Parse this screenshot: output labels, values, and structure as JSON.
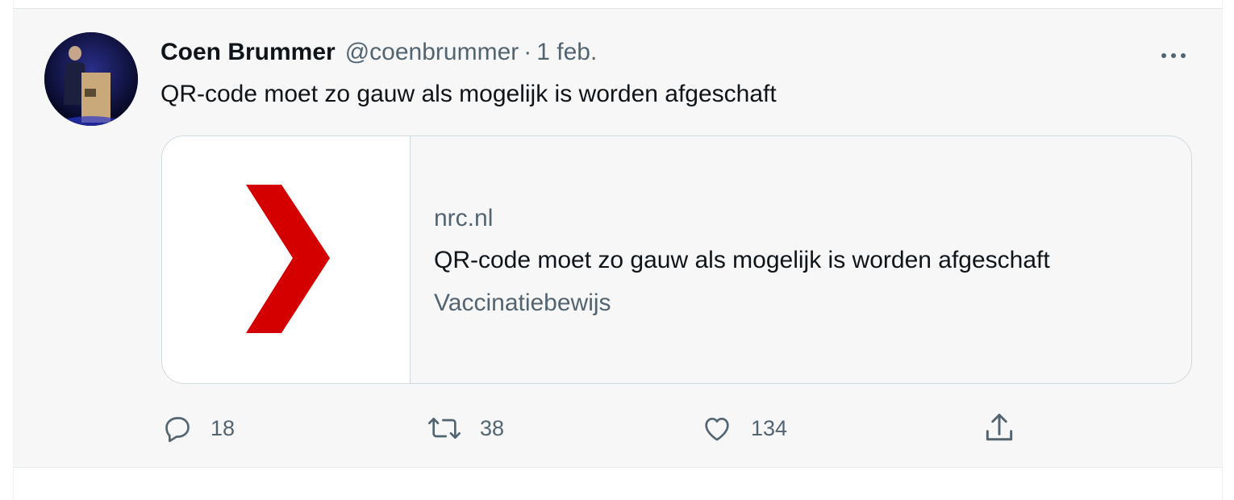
{
  "tweet": {
    "author": {
      "display_name": "Coen Brummer",
      "handle": "@coenbrummer"
    },
    "separator": "·",
    "time": "1 feb.",
    "text": "QR-code moet zo gauw als mogelijk is worden afgeschaft",
    "more_icon": "more-horizontal-icon",
    "card": {
      "thumbnail_icon": "nrc-logo-chevron",
      "domain": "nrc.nl",
      "title": "QR-code moet zo gauw als mogelijk is worden afgeschaft",
      "description": "Vaccinatiebewijs",
      "logo_color": "#d40000"
    },
    "actions": {
      "reply": {
        "icon": "reply-icon",
        "count": "18"
      },
      "retweet": {
        "icon": "retweet-icon",
        "count": "38"
      },
      "like": {
        "icon": "like-icon",
        "count": "134"
      },
      "share": {
        "icon": "share-icon"
      }
    }
  },
  "colors": {
    "tweet_background": "#f7f7f7",
    "primary_text": "#0f1419",
    "secondary_text": "#536471",
    "border": "#cfd9de"
  }
}
